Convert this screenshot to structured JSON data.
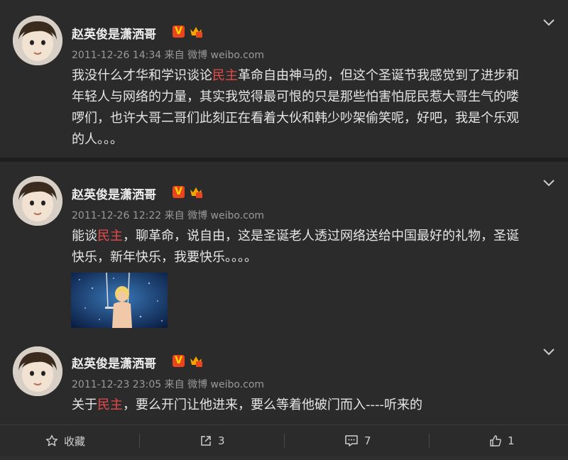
{
  "posts": [
    {
      "username": "赵英俊是潇洒哥",
      "time": "2011-12-26 14:34",
      "source": "来自 微博 weibo.com",
      "lines": [
        {
          "before": "我没什么才华和学识谈论",
          "highlight": "民主",
          "after": "革命自由神马的，但这个圣诞节我感觉到了进步和"
        },
        {
          "before": "年轻人与网络的力量，其实我觉得最可恨的只是那些怕害怕屁民惹大哥生气的喽",
          "highlight": "",
          "after": ""
        },
        {
          "before": "啰们，也许大哥二哥们此刻正在看着大伙和韩少吵架偷笑呢，好吧，我是个乐观",
          "highlight": "",
          "after": ""
        },
        {
          "before": "的人。。。",
          "highlight": "",
          "after": ""
        }
      ]
    },
    {
      "username": "赵英俊是潇洒哥",
      "time": "2011-12-26 12:22",
      "source": "来自 微博 weibo.com",
      "lines": [
        {
          "before": "能谈",
          "highlight": "民主",
          "after": "，聊革命，说自由，这是圣诞老人透过网络送给中国最好的礼物，圣诞"
        },
        {
          "before": "快乐，新年快乐，我要快乐。。。。",
          "highlight": "",
          "after": ""
        }
      ]
    },
    {
      "username": "赵英俊是潇洒哥",
      "time": "2011-12-23 23:05",
      "source": "来自 微博 weibo.com",
      "lines": [
        {
          "before": "关于",
          "highlight": "民主",
          "after": "，要么开门让他进来，要么等着他破门而入----听来的"
        }
      ]
    }
  ],
  "actions": {
    "favorite": "收藏",
    "repost_count": "3",
    "comment_count": "7",
    "like_count": "1"
  },
  "colors": {
    "highlight": "#e64b4b",
    "verified": "#e8451e"
  }
}
